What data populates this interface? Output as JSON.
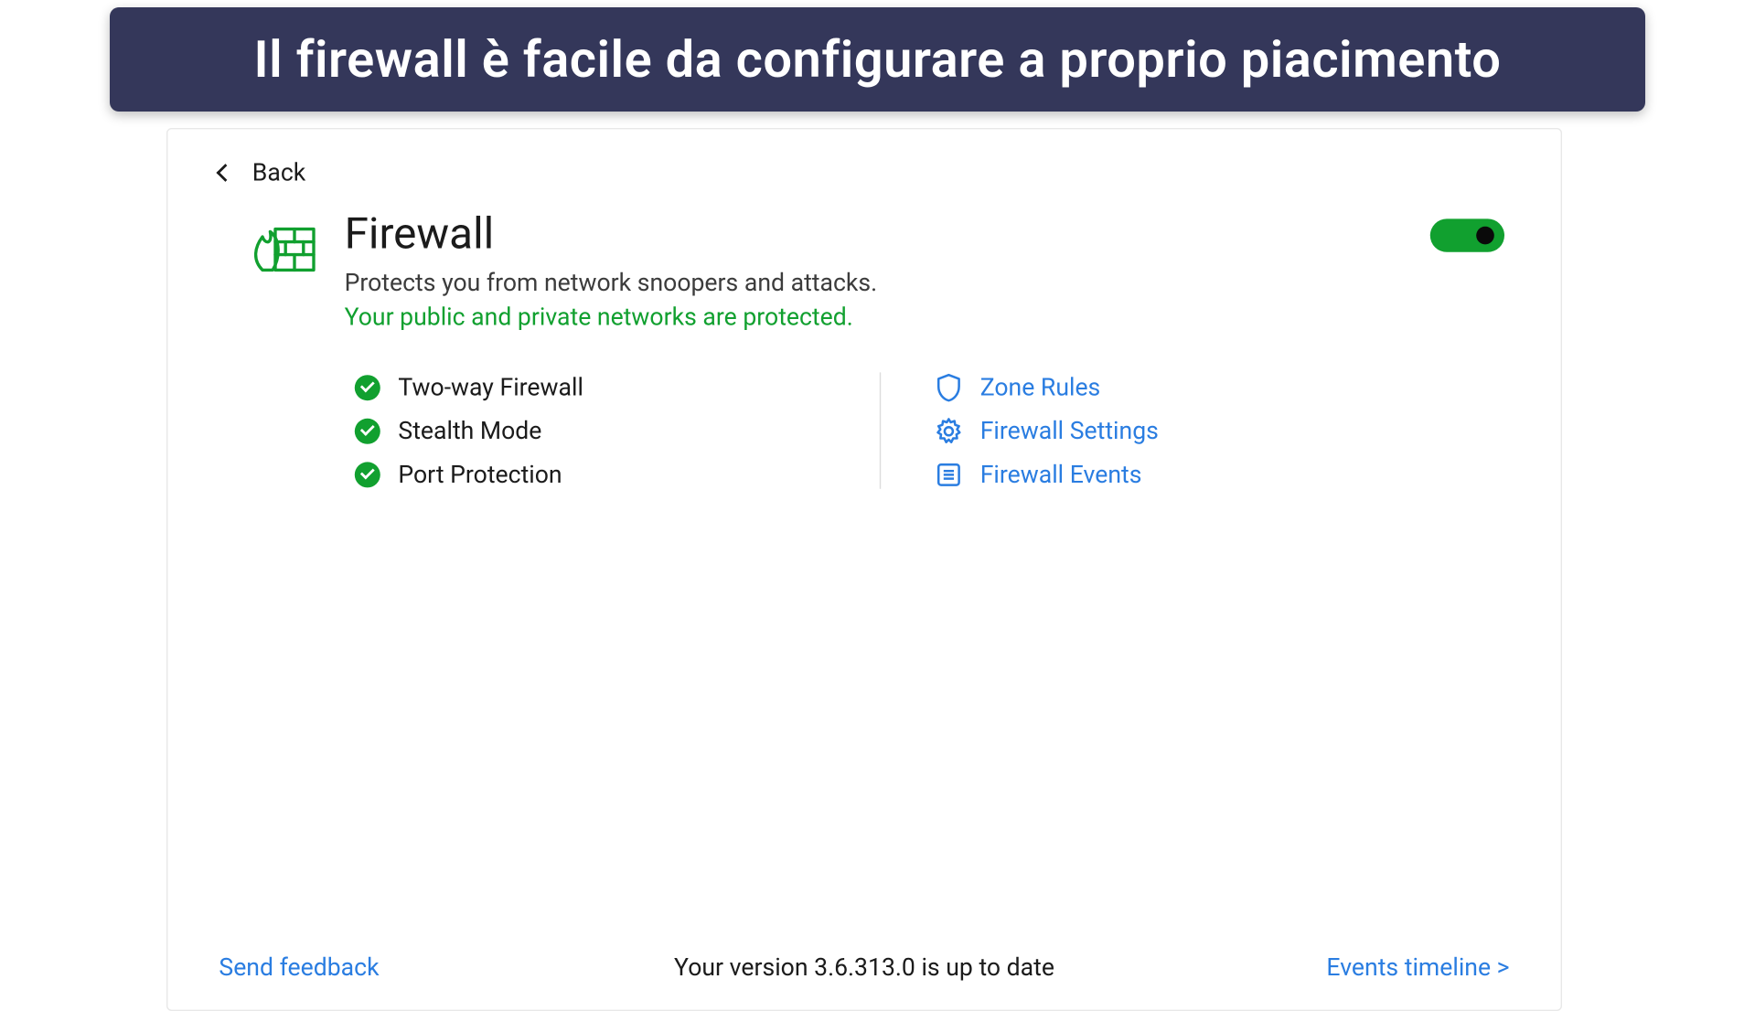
{
  "banner": {
    "text": "Il firewall è facile da configurare a proprio piacimento"
  },
  "nav": {
    "back_label": "Back"
  },
  "header": {
    "title": "Firewall",
    "description": "Protects you from network snoopers and attacks.",
    "status": "Your public and private networks are protected."
  },
  "toggle": {
    "enabled": true
  },
  "features": [
    {
      "label": "Two-way Firewall"
    },
    {
      "label": "Stealth Mode"
    },
    {
      "label": "Port Protection"
    }
  ],
  "links": [
    {
      "icon": "shield",
      "label": "Zone Rules"
    },
    {
      "icon": "gear",
      "label": "Firewall Settings"
    },
    {
      "icon": "list",
      "label": "Firewall Events"
    }
  ],
  "footer": {
    "feedback_label": "Send feedback",
    "version_text": "Your version 3.6.313.0 is up to date",
    "timeline_label": "Events timeline >"
  },
  "colors": {
    "accent_green": "#11a02f",
    "link_blue": "#2a7de1",
    "banner_bg": "#34375a"
  }
}
